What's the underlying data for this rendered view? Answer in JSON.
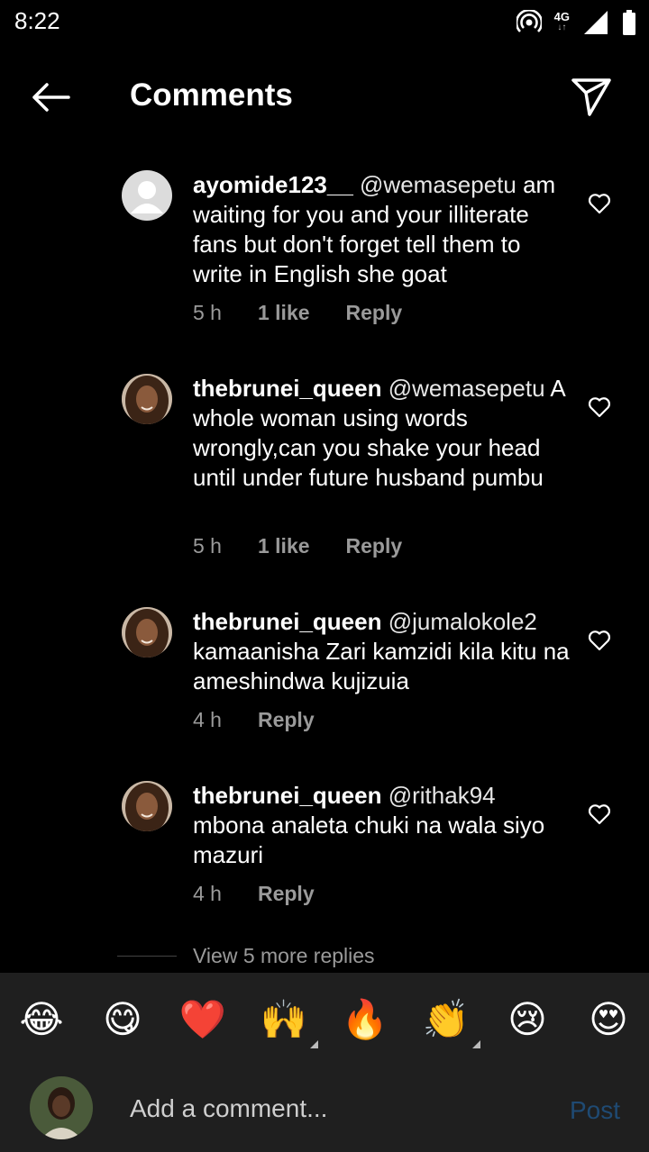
{
  "status_bar": {
    "time": "8:22",
    "network": "4G",
    "network_arrows": "↓↑"
  },
  "header": {
    "title": "Comments"
  },
  "comments": [
    {
      "username": "ayomide123__",
      "mention": "@wemasepetu",
      "text": "am waiting for you and your illiterate fans but don't forget tell them to write in English she goat",
      "time": "5 h",
      "likes": "1 like",
      "reply": "Reply",
      "avatar": "default"
    },
    {
      "username": "thebrunei_queen",
      "mention": "@wemasepetu",
      "text": "A whole woman using words wrongly,can you shake your head until under future husband pumbu",
      "time": "5 h",
      "likes": "1 like",
      "reply": "Reply",
      "avatar": "photo"
    },
    {
      "username": "thebrunei_queen",
      "mention": "@jumalokole2",
      "text": "kamaanisha Zari kamzidi kila kitu na ameshindwa kujizuia",
      "time": "4 h",
      "likes": "",
      "reply": "Reply",
      "avatar": "photo"
    },
    {
      "username": "thebrunei_queen",
      "mention": "@rithak94",
      "text": "mbona analeta chuki na wala siyo mazuri",
      "time": "4 h",
      "likes": "",
      "reply": "Reply",
      "avatar": "photo"
    }
  ],
  "view_more": "View 5 more replies",
  "emoji_bar": [
    "😂",
    "😋",
    "❤️",
    "🙌",
    "🔥",
    "👏",
    "😢",
    "😍"
  ],
  "composer": {
    "placeholder": "Add a comment...",
    "post_label": "Post"
  },
  "colors": {
    "background": "#000000",
    "panel": "#1f1f1f",
    "secondary_text": "#9a9a9a",
    "post_disabled": "#1f4a73"
  }
}
